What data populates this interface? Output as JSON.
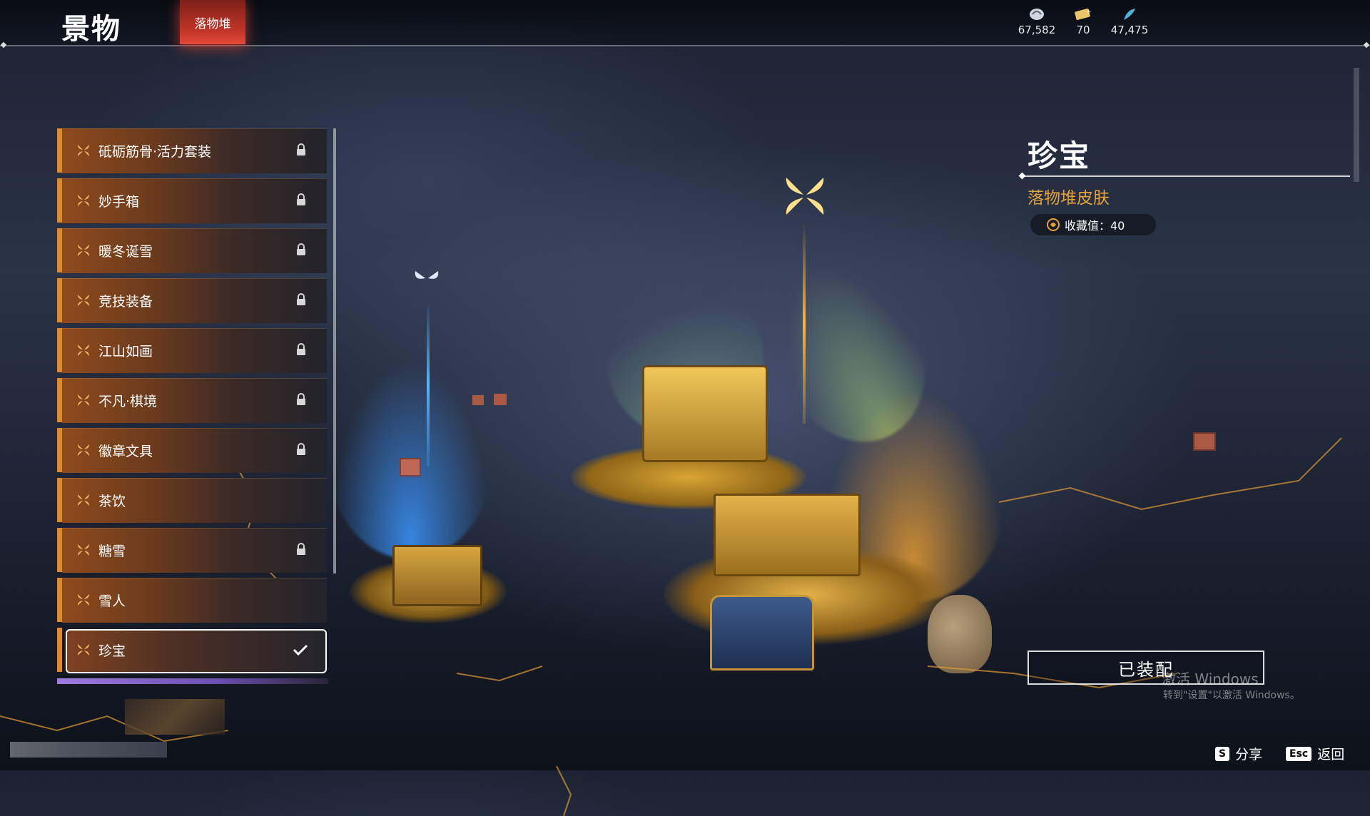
{
  "header": {
    "title": "景物",
    "active_tab": "落物堆",
    "currencies": [
      {
        "icon": "shell-currency-icon",
        "value": "67,582"
      },
      {
        "icon": "ticket-currency-icon",
        "value": "70"
      },
      {
        "icon": "feather-currency-icon",
        "value": "47,475"
      }
    ]
  },
  "list": {
    "items": [
      {
        "label": "砥砺筋骨·活力套装",
        "status": "locked"
      },
      {
        "label": "妙手箱",
        "status": "locked"
      },
      {
        "label": "暖冬诞雪",
        "status": "locked"
      },
      {
        "label": "竞技装备",
        "status": "locked"
      },
      {
        "label": "江山如画",
        "status": "locked"
      },
      {
        "label": "不凡·棋境",
        "status": "locked"
      },
      {
        "label": "徽章文具",
        "status": "locked"
      },
      {
        "label": "茶饮",
        "status": "unlocked"
      },
      {
        "label": "糖雪",
        "status": "locked"
      },
      {
        "label": "雪人",
        "status": "unlocked"
      },
      {
        "label": "珍宝",
        "status": "equipped"
      }
    ]
  },
  "detail": {
    "name": "珍宝",
    "type": "落物堆皮肤",
    "collect_label": "收藏值：40",
    "equip_button": "已装配"
  },
  "watermark": {
    "line1": "激活 Windows",
    "line2": "转到\"设置\"以激活 Windows。"
  },
  "footer": {
    "share_key": "S",
    "share_label": "分享",
    "back_key": "Esc",
    "back_label": "返回"
  },
  "colors": {
    "accent_orange": "#d88a35",
    "tab_red": "#c23527",
    "gold_text": "#e3a23c"
  }
}
